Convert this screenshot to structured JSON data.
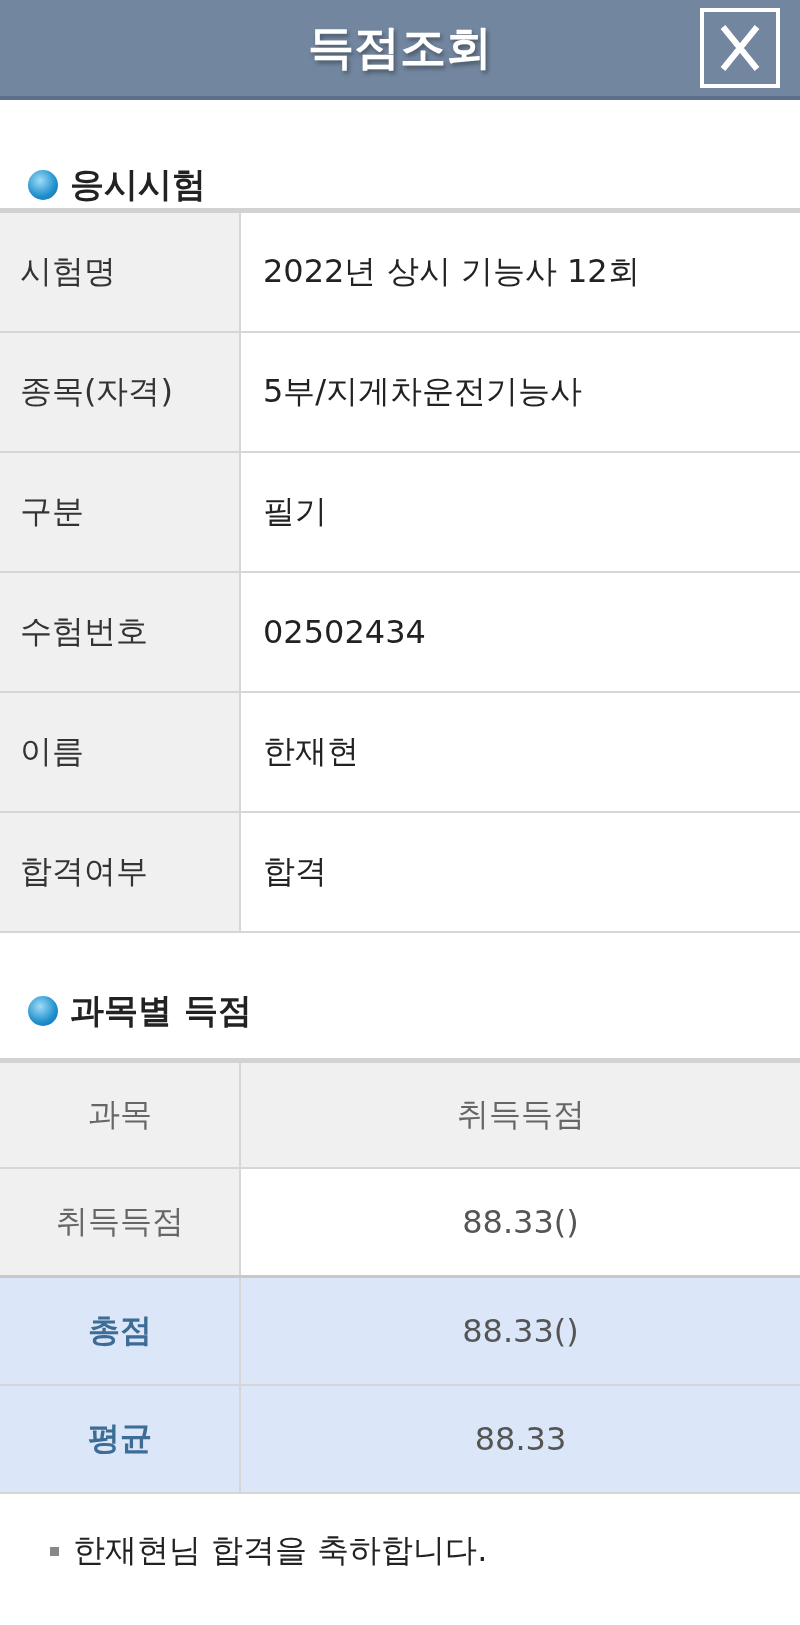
{
  "header": {
    "title": "득점조회"
  },
  "exam_section": {
    "heading": "응시시험",
    "rows": [
      {
        "label": "시험명",
        "value": "2022년 상시 기능사 12회"
      },
      {
        "label": "종목(자격)",
        "value": "5부/지게차운전기능사"
      },
      {
        "label": "구분",
        "value": "필기"
      },
      {
        "label": "수험번호",
        "value": "02502434"
      },
      {
        "label": "이름",
        "value": "한재현"
      },
      {
        "label": "합격여부",
        "value": "합격"
      }
    ]
  },
  "score_section": {
    "heading": "과목별 득점",
    "columns": [
      "과목",
      "취득득점"
    ],
    "rows": [
      {
        "kind": "subject",
        "label": "취득득점",
        "value": "88.33()"
      },
      {
        "kind": "total",
        "label": "총점",
        "value": "88.33()"
      },
      {
        "kind": "total",
        "label": "평균",
        "value": "88.33"
      }
    ]
  },
  "message": "한재현님 합격을 축하합니다."
}
